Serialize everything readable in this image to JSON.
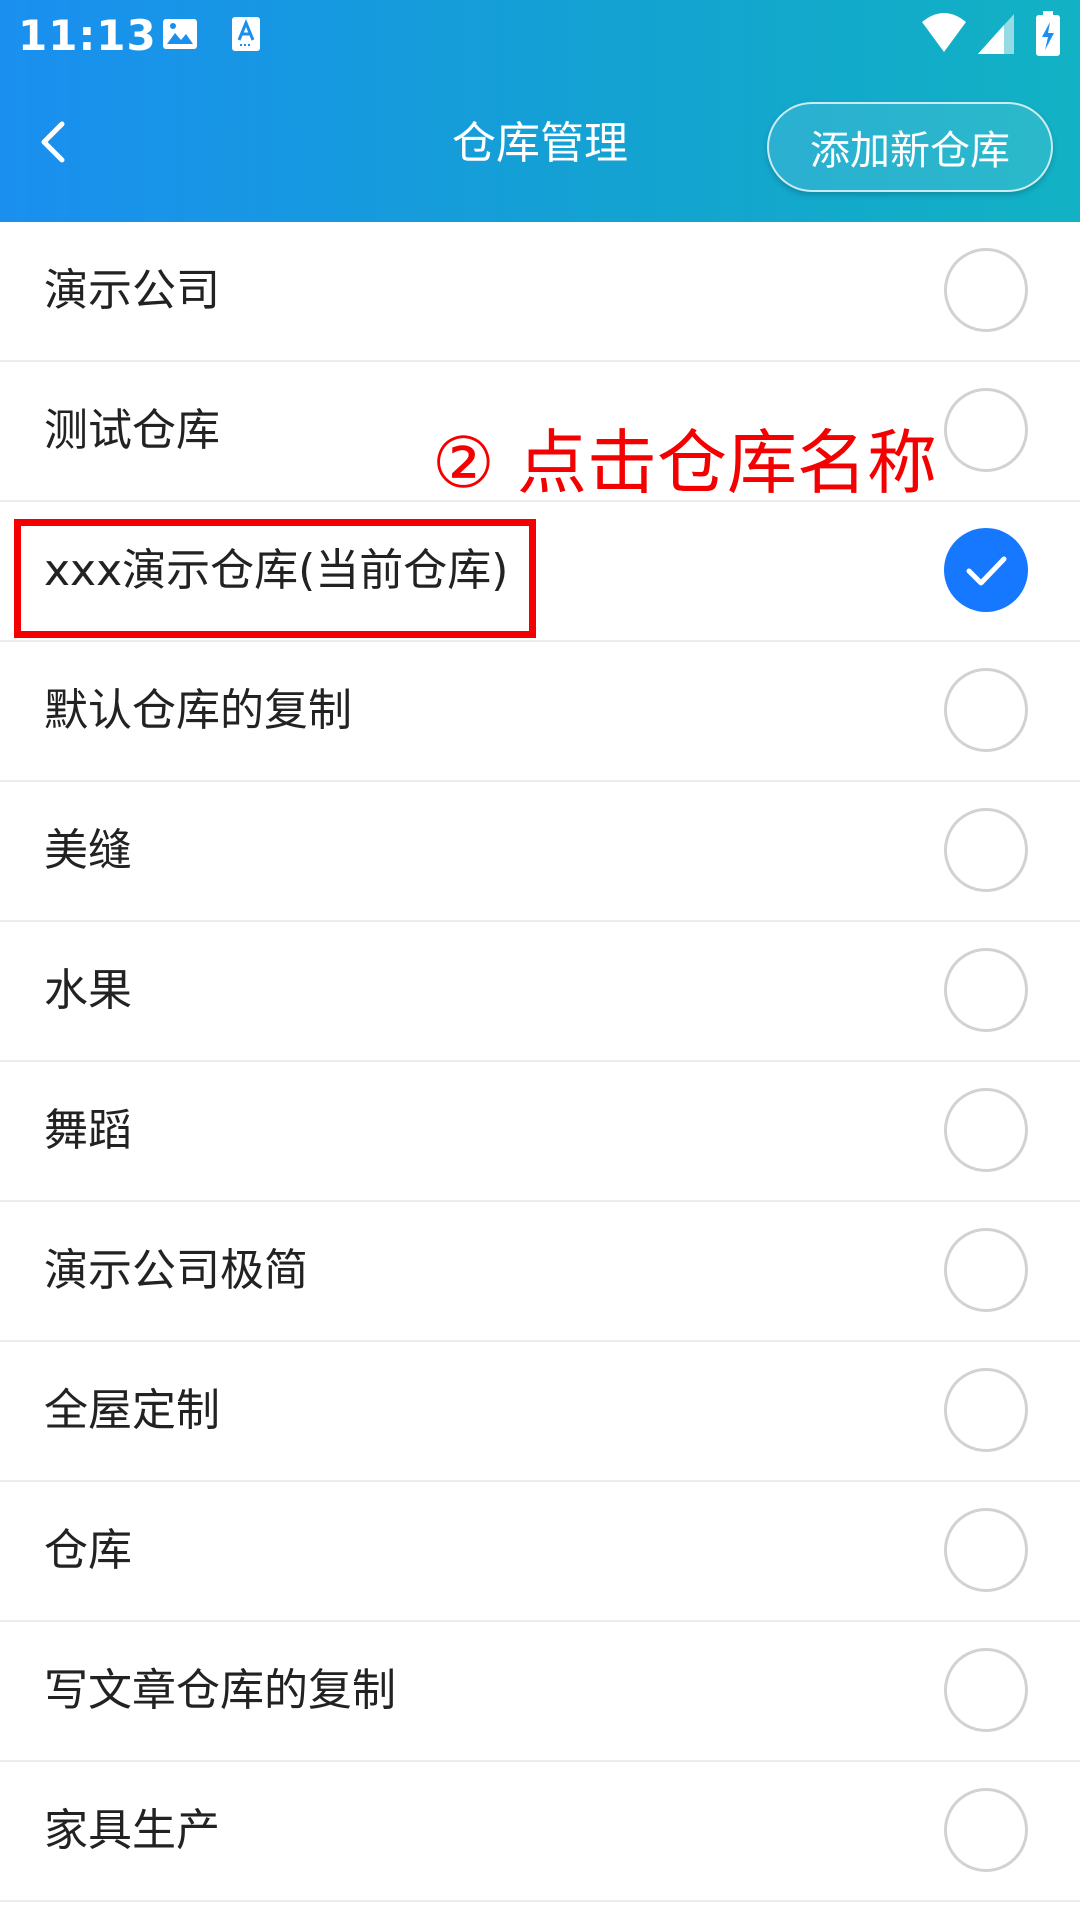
{
  "status_bar": {
    "time": "11:13",
    "icons": [
      "image-icon",
      "font-download-icon",
      "wifi-icon",
      "signal-icon",
      "battery-charging-icon"
    ]
  },
  "header": {
    "title": "仓库管理",
    "back_icon": "chevron-left-icon",
    "add_button_label": "添加新仓库",
    "background_colors": [
      "#1a8ff0",
      "#12b2c4"
    ]
  },
  "warehouses": [
    {
      "name": "演示公司",
      "selected": false
    },
    {
      "name": "测试仓库",
      "selected": false
    },
    {
      "name": "xxx演示仓库(当前仓库)",
      "selected": true
    },
    {
      "name": "默认仓库的复制",
      "selected": false
    },
    {
      "name": "美缝",
      "selected": false
    },
    {
      "name": "水果",
      "selected": false
    },
    {
      "name": "舞蹈",
      "selected": false
    },
    {
      "name": "演示公司极简",
      "selected": false
    },
    {
      "name": "全屋定制",
      "selected": false
    },
    {
      "name": "仓库",
      "selected": false
    },
    {
      "name": "写文章仓库的复制",
      "selected": false
    },
    {
      "name": "家具生产",
      "selected": false
    }
  ],
  "annotation": {
    "text": "② 点击仓库名称",
    "color": "#f40000"
  },
  "colors": {
    "accent": "#1677ff",
    "radio_border": "#d2d2d2",
    "divider": "#ececec"
  }
}
